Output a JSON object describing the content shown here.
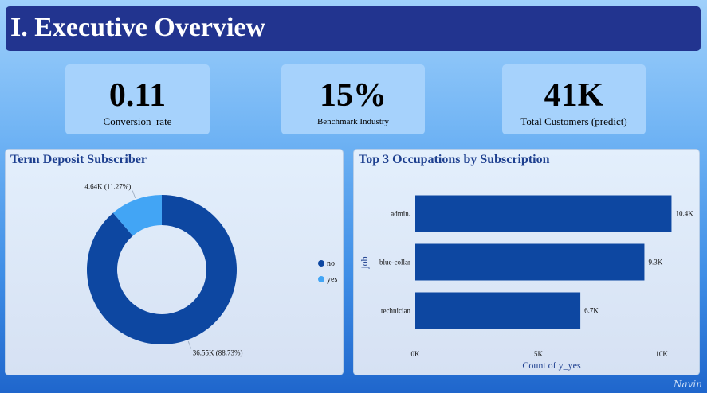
{
  "header": {
    "title": "I. Executive Overview"
  },
  "kpis": [
    {
      "value": "0.11",
      "label": "Conversion_rate"
    },
    {
      "value": "15%",
      "label": "Benchmark Industry"
    },
    {
      "value": "41K",
      "label": "Total Customers (predict)"
    }
  ],
  "colors": {
    "no": "#0d47a1",
    "yes": "#42a5f5",
    "bar": "#0d47a1",
    "header": "#22348f"
  },
  "watermark": "Navin",
  "chart_data": [
    {
      "type": "pie",
      "title": "Term Deposit Subscriber",
      "hole": true,
      "slices": [
        {
          "name": "no",
          "value": 36.55,
          "label": "36.55K (88.73%)"
        },
        {
          "name": "yes",
          "value": 4.64,
          "label": "4.64K (11.27%)"
        }
      ],
      "legend": "right"
    },
    {
      "type": "bar",
      "orientation": "horizontal",
      "title": "Top 3 Occupations by Subscription",
      "categories": [
        "admin.",
        "blue-collar",
        "technician"
      ],
      "values": [
        10.4,
        9.3,
        6.7
      ],
      "value_labels": [
        "10.4K",
        "9.3K",
        "6.7K"
      ],
      "xlabel": "Count of y_yes",
      "ylabel": "job",
      "xticks": [
        0,
        5,
        10
      ],
      "xtick_labels": [
        "0K",
        "5K",
        "10K"
      ],
      "xlim": [
        0,
        11
      ]
    }
  ]
}
